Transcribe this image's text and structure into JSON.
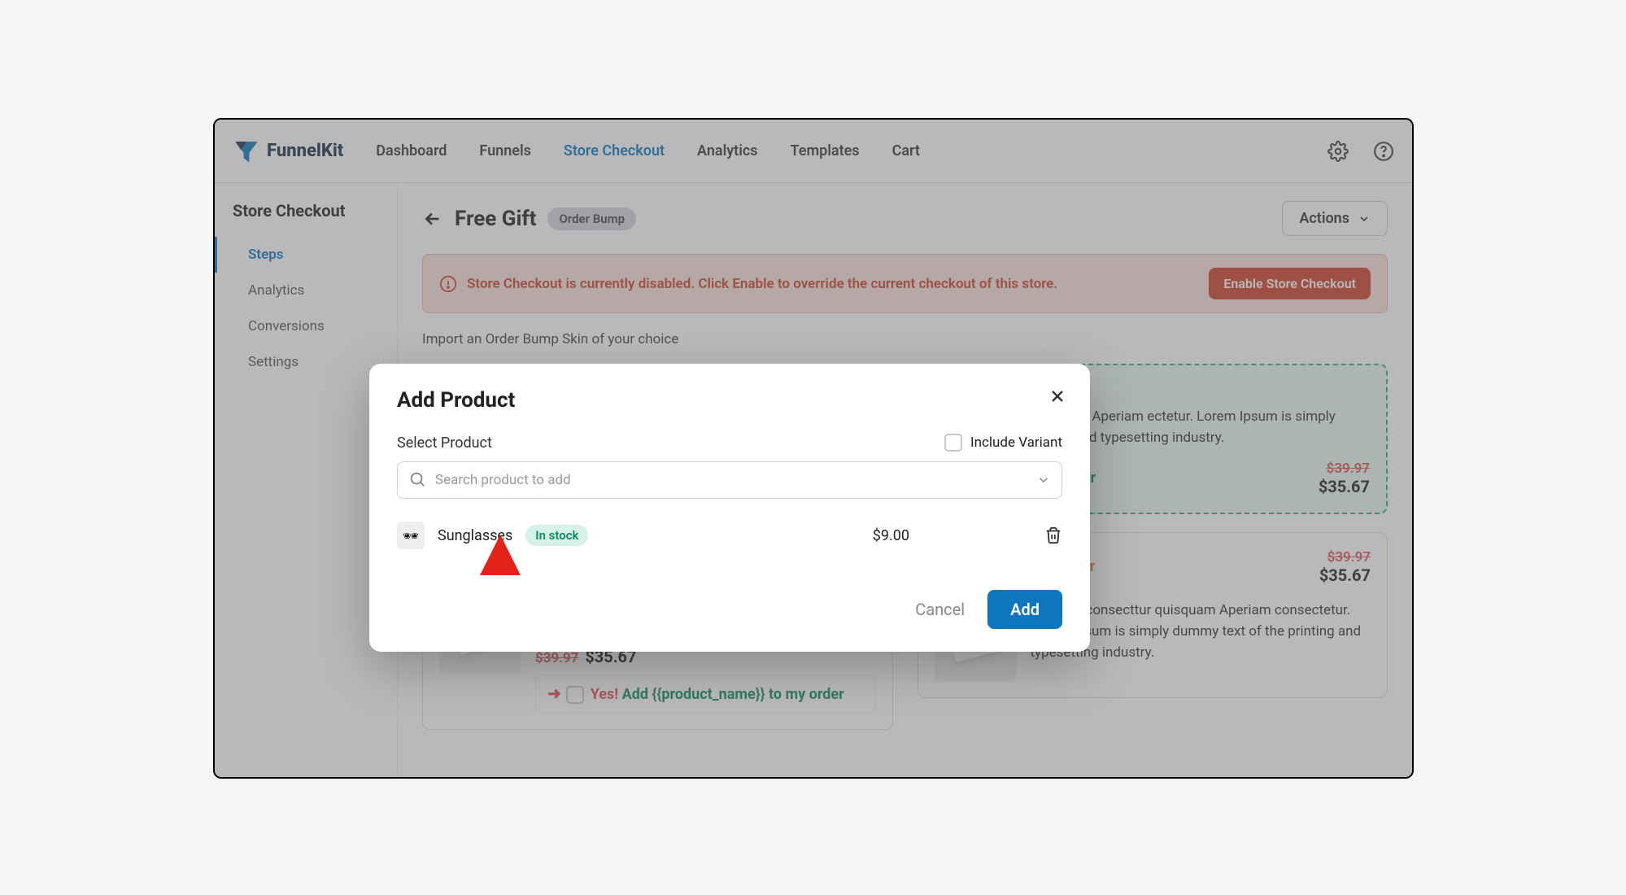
{
  "brand": "FunnelKit",
  "nav": {
    "dashboard": "Dashboard",
    "funnels": "Funnels",
    "store_checkout": "Store Checkout",
    "analytics": "Analytics",
    "templates": "Templates",
    "cart": "Cart"
  },
  "sidebar": {
    "title": "Store Checkout",
    "steps": "Steps",
    "analytics": "Analytics",
    "conversions": "Conversions",
    "settings": "Settings"
  },
  "page": {
    "title": "Free Gift",
    "badge": "Order Bump",
    "actions": "Actions",
    "alert_text": "Store Checkout is currently disabled. Click Enable to override the current checkout of this store.",
    "alert_btn": "Enable Store Checkout",
    "subtext": "Import an Order Bump Skin of your choice"
  },
  "card": {
    "offer_label": "sive Offer",
    "desc": "am consecttur quisquam Aperiam ectetur. Lorem Ipsum is simply dummy of the printing and typesetting industry.",
    "desc_full": "Aperiam consecttur quisquam Aperiam consectetur. Lorem Ipsum is simply dummy text of the printing and typesetting industry.",
    "add_line_prefix": "duct_name}} to my order",
    "yes": "Yes!",
    "add_line_green": "Add {{product_name}} to my order",
    "add_line_orange": "duct_name}} to my order",
    "price_old": "$39.97",
    "price_new": "$35.67"
  },
  "modal": {
    "title": "Add Product",
    "label": "Select Product",
    "include_variant": "Include Variant",
    "search_placeholder": "Search product to add",
    "product_name": "Sunglasses",
    "stock": "In stock",
    "product_price": "$9.00",
    "cancel": "Cancel",
    "add": "Add"
  }
}
